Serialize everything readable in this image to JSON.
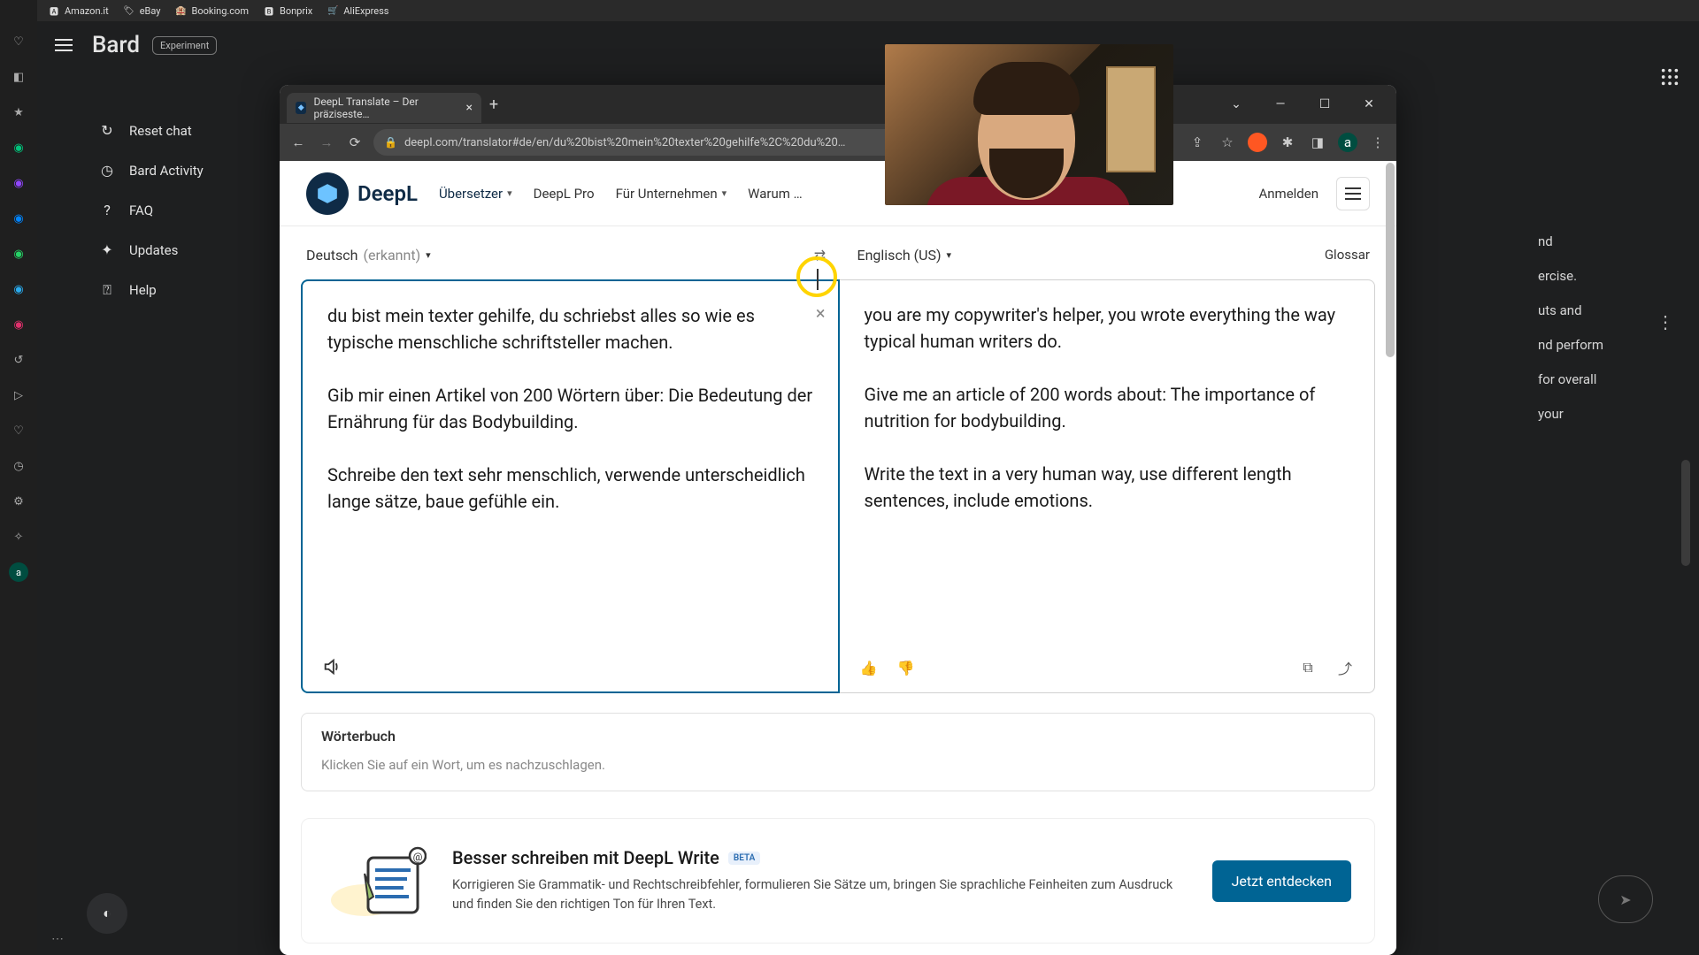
{
  "bookmarks": {
    "b0": {
      "label": "Amazon.it",
      "emoji": "a"
    },
    "b1": {
      "label": "eBay",
      "emoji": "e"
    },
    "b2": {
      "label": "Booking.com",
      "emoji": "B"
    },
    "b3": {
      "label": "Bonprix",
      "emoji": "b"
    },
    "b4": {
      "label": "AliExpress",
      "emoji": "A"
    }
  },
  "bard": {
    "title": "Bard",
    "badge": "Experiment",
    "side": {
      "s0": "Reset chat",
      "s1": "Bard Activity",
      "s2": "FAQ",
      "s3": "Updates",
      "s4": "Help"
    },
    "peek": {
      "l0": "nd",
      "l1": "ercise.",
      "l2": "uts and",
      "l3": "nd perform",
      "l4": "for overall",
      "l5": "your"
    }
  },
  "browser": {
    "tab_title": "DeepL Translate – Der präziseste…",
    "url": "deepl.com/translator#de/en/du%20bist%20mein%20texter%20gehilfe%2C%20du%20…",
    "avatar_letter": "a"
  },
  "deepl": {
    "logo_text": "DeepL",
    "nav": {
      "n0": "Übersetzer",
      "n1": "DeepL Pro",
      "n2": "Für Unternehmen",
      "n3": "Warum …"
    },
    "login": "Anmelden",
    "src_lang": "Deutsch",
    "src_lang_detected": "(erkannt)",
    "tgt_lang": "Englisch (US)",
    "glossar": "Glossar",
    "src_text": "du bist mein texter gehilfe, du schriebst alles so wie es typische menschliche schriftsteller machen.\n\nGib mir einen Artikel von 200 Wörtern über: Die Bedeutung der Ernährung für das Bodybuilding.\n\nSchreibe den text sehr menschlich, verwende unterscheidlich lange sätze, baue gefühle ein.",
    "tgt_text": "you are my copywriter's helper, you wrote everything the way typical human writers do.\n\nGive me an article of 200 words about: The importance of nutrition for bodybuilding.\n\nWrite the text in a very human way, use different length sentences, include emotions.",
    "dict_head": "Wörterbuch",
    "dict_body": "Klicken Sie auf ein Wort, um es nachzuschlagen.",
    "promo_title": "Besser schreiben mit DeepL Write",
    "promo_beta": "BETA",
    "promo_desc": "Korrigieren Sie Grammatik- und Rechtschreibfehler, formulieren Sie Sätze um, bringen Sie sprachliche Feinheiten zum Ausdruck und finden Sie den richtigen Ton für Ihren Text.",
    "promo_btn": "Jetzt entdecken"
  }
}
